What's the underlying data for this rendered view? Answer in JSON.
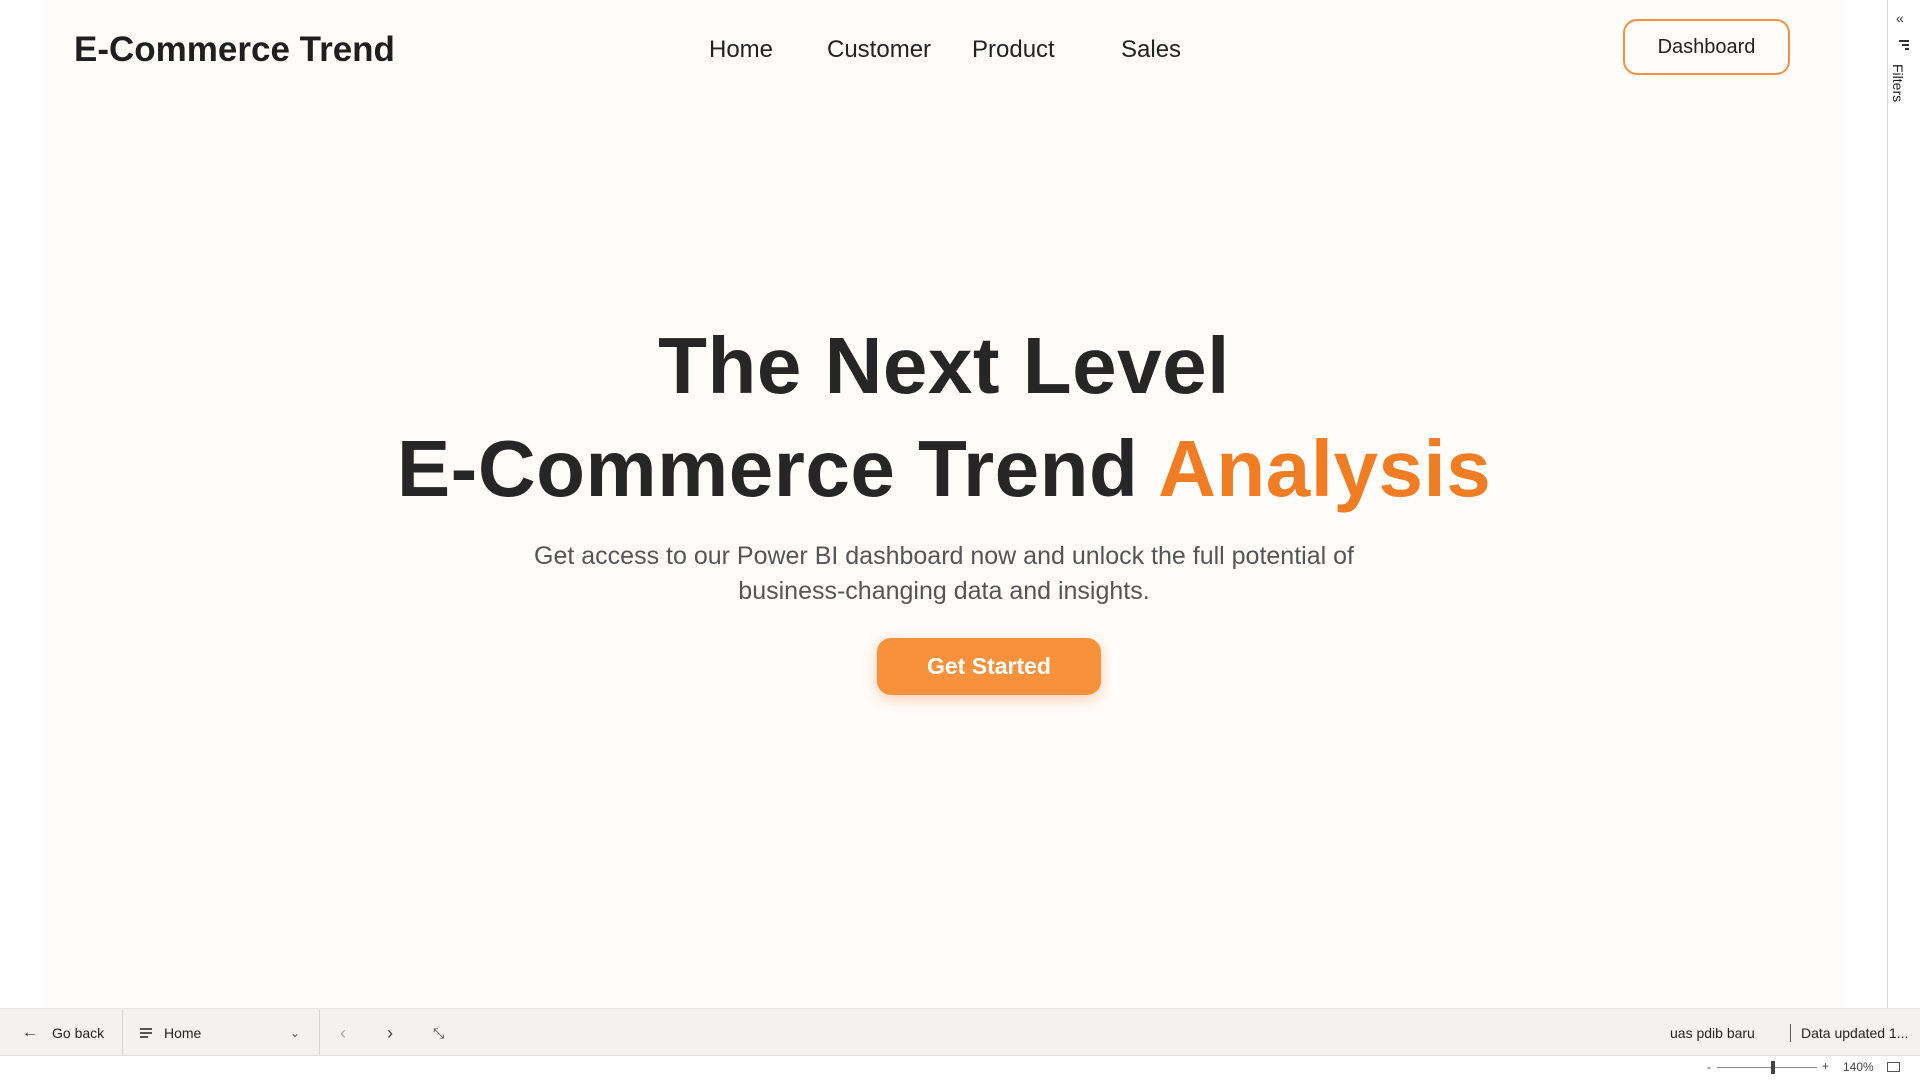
{
  "header": {
    "brand": "E-Commerce Trend",
    "nav": [
      "Home",
      "Customer",
      "Product",
      "Sales"
    ],
    "dashboard_label": "Dashboard"
  },
  "hero": {
    "line1": "The Next Level",
    "line2_main": "E-Commerce Trend ",
    "line2_accent": "Analysis",
    "subtitle_line1": "Get access to our Power BI dashboard now and unlock the full potential of",
    "subtitle_line2": "business-changing data and insights.",
    "cta_label": "Get Started"
  },
  "filters_pane": {
    "label": "Filters",
    "collapse_icon": "chevron-double-left-icon"
  },
  "bottom_bar": {
    "go_back_label": "Go back",
    "page_label": "Home",
    "report_name": "uas pdib baru",
    "data_updated": "Data updated 1..."
  },
  "zoom": {
    "minus": "-",
    "plus": "+",
    "percent_label": "140%",
    "level": 140
  },
  "colors": {
    "accent": "#f07c23",
    "cta_bg": "#f8913b",
    "canvas_bg": "#fffcfa",
    "text_dark": "#262626"
  }
}
